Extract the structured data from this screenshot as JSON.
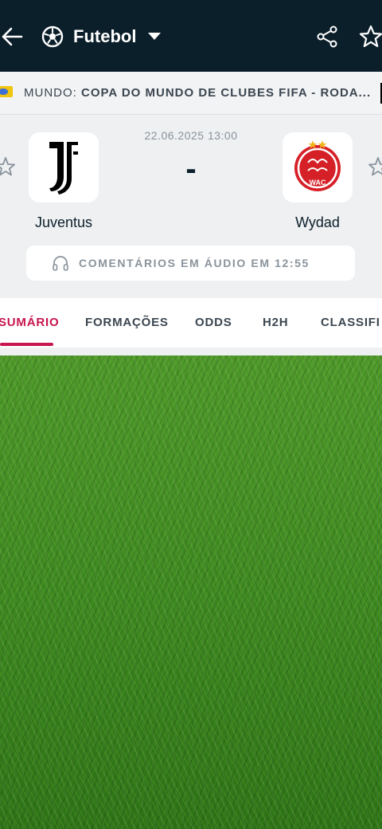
{
  "app_bar": {
    "title": "Futebol",
    "back_icon": "arrow-left-icon",
    "sport_icon": "soccer-ball-icon",
    "share_icon": "share-icon",
    "favorite_icon": "star-outline-icon"
  },
  "competition": {
    "country": "MUNDO:",
    "name": "COPA DO MUNDO DE CLUBES FIFA - RODA..."
  },
  "match": {
    "datetime": "22.06.2025 13:00",
    "score": "-",
    "home": {
      "name": "Juventus"
    },
    "away": {
      "name": "Wydad"
    },
    "audio_commentary": "COMENTÁRIOS EM ÁUDIO EM 12:55"
  },
  "tabs": [
    "SUMÁRIO",
    "FORMAÇÕES",
    "ODDS",
    "H2H",
    "CLASSIFI"
  ],
  "colors": {
    "header_bg": "#0b1f2a",
    "accent": "#c8154d",
    "wydad_red": "#d62027"
  }
}
